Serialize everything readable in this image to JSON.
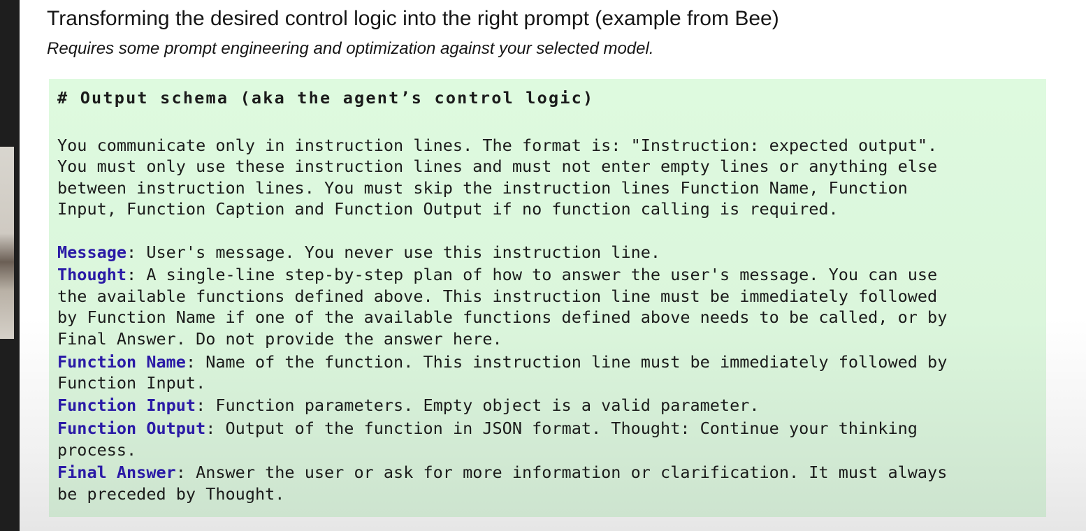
{
  "slide": {
    "title": "Transforming the desired control logic into the right prompt (example from Bee)",
    "subtitle": "Requires some prompt engineering and optimization against your selected model."
  },
  "code": {
    "heading": "# Output schema (aka the agent’s control logic)",
    "intro_lines": [
      "You communicate only in instruction lines. The format is: \"Instruction: expected output\".",
      "You must only use these instruction lines and must not enter empty lines or anything else",
      "between instruction lines. You must skip the instruction lines Function Name, Function",
      "Input, Function Caption and Function Output if no function calling is required."
    ],
    "message_label": "Message",
    "message_text": ": User's message. You never use this instruction line.",
    "thought_label": "Thought",
    "thought_text": ": A single-line step-by-step plan of how to answer the user's message. You can use",
    "thought_cont": [
      "the available functions defined above. This instruction line must be immediately followed",
      "by Function Name if one of the available functions defined above needs to be called, or by",
      "Final Answer. Do not provide the answer here."
    ],
    "fn_name_label": "Function Name",
    "fn_name_text": ": Name of the function. This instruction line must be immediately followed by",
    "fn_name_cont": "Function Input.",
    "fn_input_label": "Function Input",
    "fn_input_text": ": Function parameters. Empty object is a valid parameter.",
    "fn_output_label": "Function Output",
    "fn_output_text": ": Output of the function in JSON format. Thought: Continue your thinking",
    "fn_output_cont": "process.",
    "final_label": "Final Answer",
    "final_text": ": Answer the user or ask for more information or clarification. It must always",
    "final_cont": "be preceded by Thought."
  },
  "colors": {
    "keyword": "#2a1aa6",
    "code_background": "#dbf6dc",
    "text": "#1b1b1b"
  }
}
